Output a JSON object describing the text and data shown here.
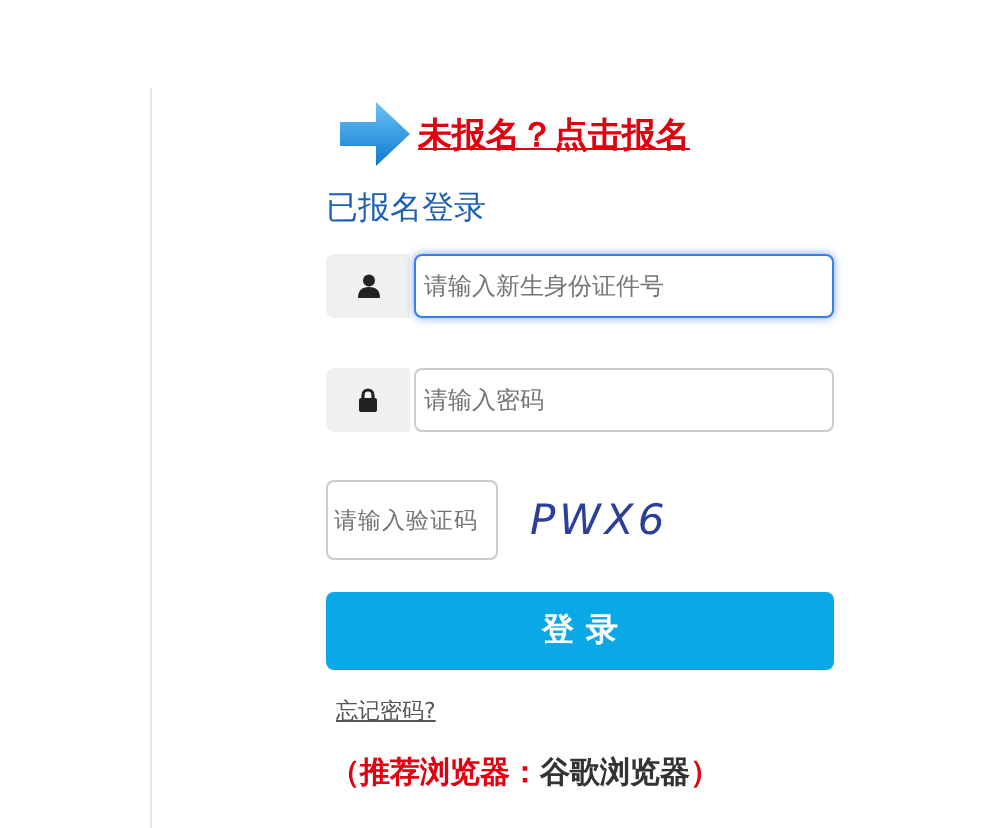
{
  "register_link": "未报名？点击报名",
  "heading": "已报名登录",
  "fields": [
    {
      "kind": "user",
      "placeholder": "请输入新生身份证件号",
      "focused": true
    },
    {
      "kind": "lock",
      "placeholder": "请输入密码",
      "focused": false
    }
  ],
  "captcha": {
    "placeholder": "请输入验证码",
    "code": "PWX6"
  },
  "login_button": "登 录",
  "forgot_link": "忘记密码?",
  "browser_note": {
    "prefix": "（推荐浏览器：",
    "value": "谷歌浏览器",
    "suffix": "）"
  }
}
